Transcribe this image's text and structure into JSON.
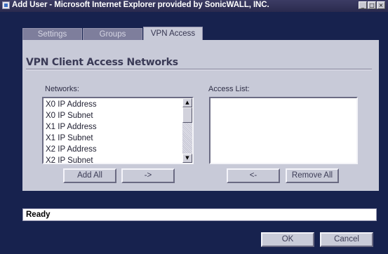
{
  "window": {
    "title": "Add User - Microsoft Internet Explorer provided by SonicWALL, INC.",
    "controls": [
      "_",
      "□",
      "×"
    ]
  },
  "tabs": [
    {
      "label": "Settings",
      "active": false
    },
    {
      "label": "Groups",
      "active": false
    },
    {
      "label": "VPN Access",
      "active": true
    }
  ],
  "panel": {
    "title": "VPN Client Access Networks",
    "networks_label": "Networks:",
    "access_list_label": "Access List:",
    "networks": [
      "X0 IP Address",
      "X0 IP Subnet",
      "X1 IP Address",
      "X1 IP Subnet",
      "X2 IP Address",
      "X2 IP Subnet"
    ],
    "access_list": [],
    "buttons": {
      "add_all": "Add All",
      "add": "->",
      "remove": "<-",
      "remove_all": "Remove All"
    }
  },
  "status": {
    "text": "Ready"
  },
  "footer": {
    "ok": "OK",
    "cancel": "Cancel"
  },
  "icons": {
    "window_icon": "ie-page-icon",
    "scroll_up": "up-arrow-icon",
    "scroll_down": "down-arrow-icon"
  },
  "colors": {
    "background": "#17224e",
    "panel": "#c8cad8",
    "inactive_tab": "#7e7e9c"
  }
}
